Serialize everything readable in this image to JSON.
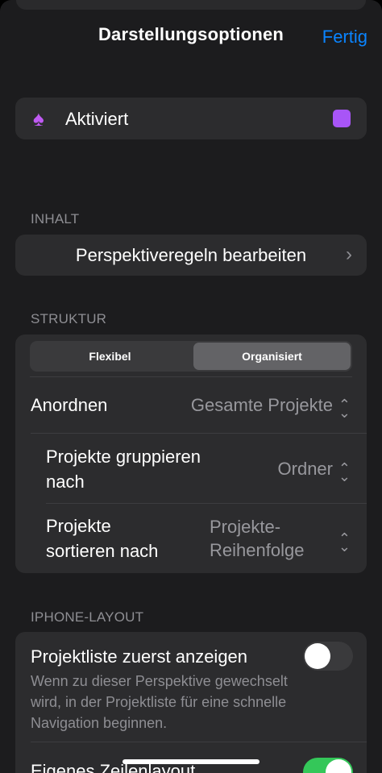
{
  "nav": {
    "title": "Darstellungsoptionen",
    "done_label": "Fertig"
  },
  "activated": {
    "label": "Aktiviert",
    "icon": "spade-icon",
    "color": "#a855f7"
  },
  "sections": {
    "inhalt": {
      "header": "INHALT",
      "edit_rules_label": "Perspektiveregeln bearbeiten"
    },
    "struktur": {
      "header": "STRUKTUR",
      "segments": [
        "Flexibel",
        "Organisiert"
      ],
      "selected_segment": "Organisiert",
      "rows": {
        "arrange": {
          "label": "Anordnen",
          "value": "Gesamte Projekte"
        },
        "group": {
          "label_line1": "Projekte gruppieren",
          "label_line2": "nach",
          "value": "Ordner"
        },
        "sort": {
          "label_line1": "Projekte",
          "label_line2": "sortieren nach",
          "value_line1": "Projekte-",
          "value_line2": "Reihenfolge"
        }
      }
    },
    "iphone_layout": {
      "header": "IPHONE-LAYOUT",
      "show_project_list": {
        "label": "Projektliste zuerst anzeigen",
        "description": "Wenn zu dieser Perspektive gewechselt wird, in der Projektliste für eine schnelle Navigation beginnen.",
        "enabled": false
      },
      "own_row_layout": {
        "label": "Eigenes Zeilenlayout",
        "enabled": true
      }
    }
  },
  "colors": {
    "accent": "#0a84ff",
    "toggle_on": "#34c759",
    "purple": "#bf5af2"
  }
}
